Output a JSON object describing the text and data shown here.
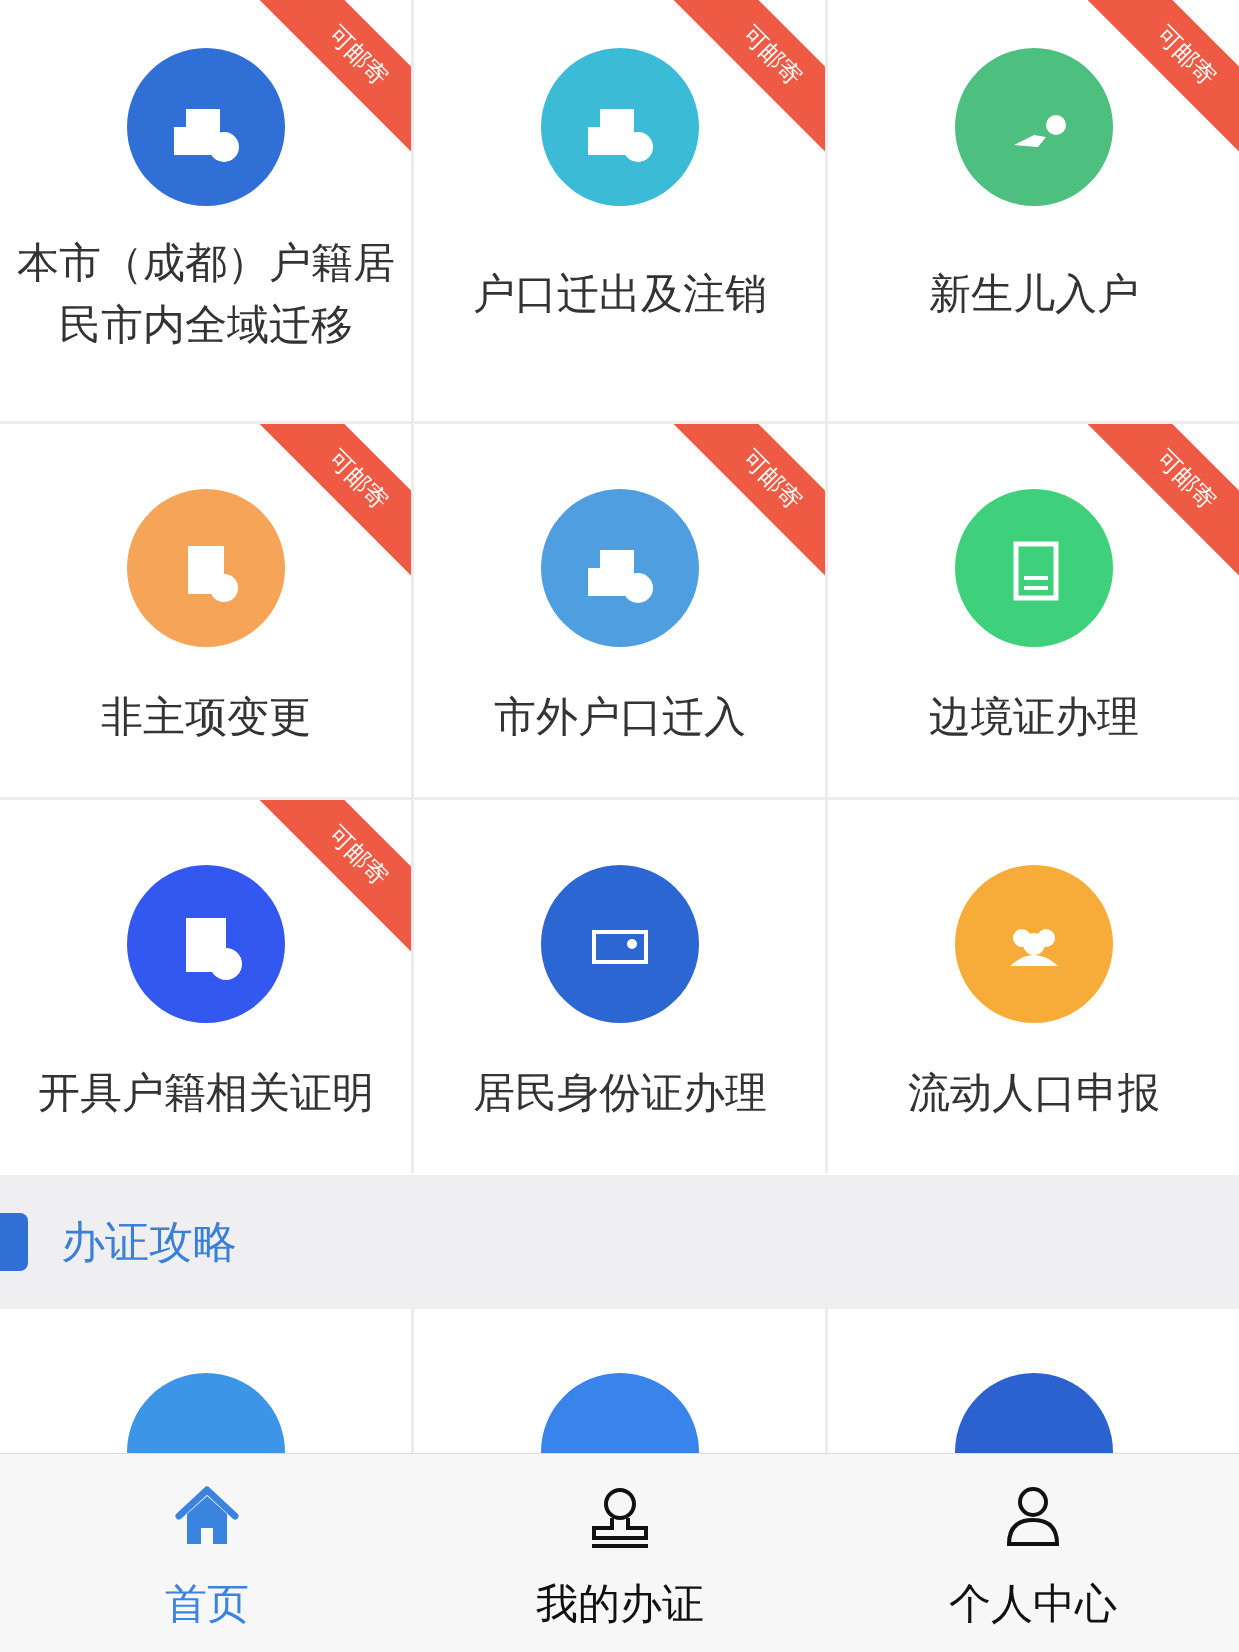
{
  "services": [
    {
      "label": "本市（成都）户籍居民市内全域迁移",
      "color": "#2f6fd6",
      "ribbon": "可邮寄"
    },
    {
      "label": "户口迁出及注销",
      "color": "#3bbbd6",
      "ribbon": "可邮寄"
    },
    {
      "label": "新生儿入户",
      "color": "#4dbf7e",
      "ribbon": "可邮寄"
    },
    {
      "label": "非主项变更",
      "color": "#f5a458",
      "ribbon": "可邮寄"
    },
    {
      "label": "市外户口迁入",
      "color": "#4f9fe0",
      "ribbon": "可邮寄"
    },
    {
      "label": "边境证办理",
      "color": "#3fd07c",
      "ribbon": "可邮寄"
    },
    {
      "label": "开具户籍相关证明",
      "color": "#3358f0",
      "ribbon": "可邮寄"
    },
    {
      "label": "居民身份证办理",
      "color": "#2c66d2"
    },
    {
      "label": "流动人口申报",
      "color": "#f7ac3a"
    }
  ],
  "section": {
    "title": "办证攻略"
  },
  "guide_items": [
    {
      "color": "#3d95e8"
    },
    {
      "color": "#3984ea"
    },
    {
      "color": "#2c62cf"
    }
  ],
  "nav": [
    {
      "label": "首页",
      "selected": true
    },
    {
      "label": "我的办证",
      "selected": false
    },
    {
      "label": "个人中心",
      "selected": false
    }
  ]
}
